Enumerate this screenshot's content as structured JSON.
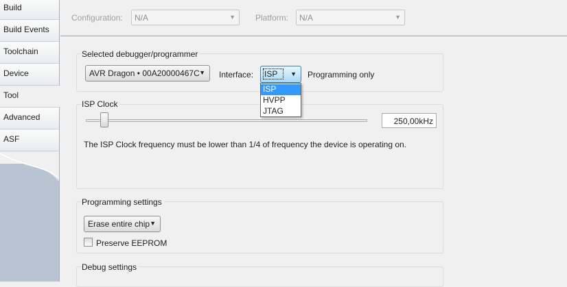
{
  "sidebar": {
    "items": [
      {
        "label": "Build"
      },
      {
        "label": "Build Events"
      },
      {
        "label": "Toolchain"
      },
      {
        "label": "Device"
      },
      {
        "label": "Tool"
      },
      {
        "label": "Advanced"
      },
      {
        "label": "ASF"
      }
    ],
    "active": "Tool"
  },
  "topbar": {
    "configuration_label": "Configuration:",
    "configuration_value": "N/A",
    "platform_label": "Platform:",
    "platform_value": "N/A"
  },
  "debugger_group": {
    "title": "Selected debugger/programmer",
    "tool_value": "AVR Dragon • 00A20000467C",
    "interface_label": "Interface:",
    "interface_value": "ISP",
    "interface_options": [
      "ISP",
      "HVPP",
      "JTAG"
    ],
    "mode_text": "Programming only"
  },
  "isp_clock_group": {
    "title": "ISP Clock",
    "clock_value": "250,00kHz",
    "note": "The ISP Clock frequency must be lower than 1/4 of frequency the device is operating on."
  },
  "programming_group": {
    "title": "Programming settings",
    "erase_value": "Erase entire chip",
    "preserve_eeprom_label": "Preserve EEPROM"
  },
  "debug_group": {
    "title": "Debug settings"
  },
  "colors": {
    "selection": "#3399ff",
    "sidebar_bg": "#b9c4d2",
    "accent_border": "#3c7fb1"
  }
}
